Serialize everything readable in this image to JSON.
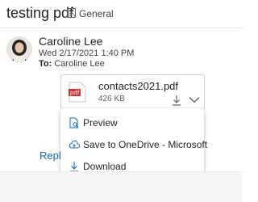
{
  "header": {
    "subject": "testing pdf",
    "category_icon": "tag-icon",
    "category": "General"
  },
  "message": {
    "sender": "Caroline Lee",
    "date": "Wed 2/17/2021 1:40 PM",
    "to_label": "To:",
    "to_value": "Caroline Lee"
  },
  "attachment": {
    "icon": "pdf-file-icon",
    "icon_text": "pdf",
    "file_name": "contacts2021.pdf",
    "file_size": "426 KB"
  },
  "menu": {
    "items": [
      {
        "label": "Preview",
        "icon": "preview-icon"
      },
      {
        "label": "Save to OneDrive - Microsoft",
        "icon": "cloud-upload-icon"
      },
      {
        "label": "Download",
        "icon": "download-icon"
      }
    ]
  },
  "reply_label": "Reply",
  "colors": {
    "accent": "#0f6cbd",
    "pdf_red": "#d13438",
    "annotation_red": "#e81123"
  }
}
